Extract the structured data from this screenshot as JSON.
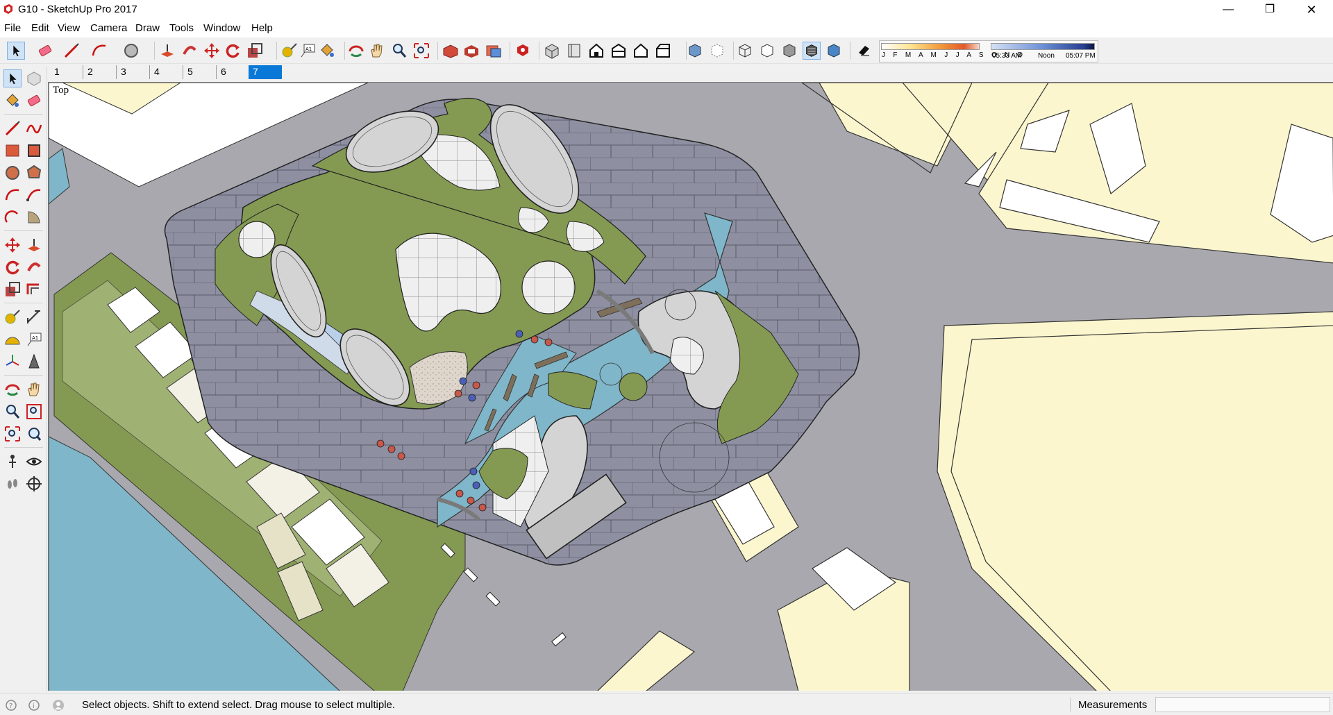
{
  "window": {
    "title": "G10 - SketchUp Pro 2017",
    "minimize_icon": "minimize-icon",
    "maximize_icon": "restore-icon",
    "close_icon": "close-icon"
  },
  "menu": [
    "File",
    "Edit",
    "View",
    "Camera",
    "Draw",
    "Tools",
    "Window",
    "Help"
  ],
  "toolbar": {
    "tools": [
      "select",
      "eraser",
      "line",
      "arc",
      "circle",
      "push-pull",
      "follow-me",
      "move",
      "rotate",
      "scale",
      "tape-measure",
      "text",
      "paint-bucket",
      "orbit",
      "pan",
      "zoom",
      "zoom-extents",
      "3d-warehouse",
      "extension-warehouse",
      "send-to-layout",
      "extension-manager",
      "iso-view",
      "top-view",
      "front-view",
      "right-view",
      "back-view",
      "left-view",
      "xray",
      "back-edges",
      "wireframe",
      "hidden-line",
      "shaded",
      "shaded-textures",
      "monochrome",
      "shadows"
    ],
    "shadow_months": "J F M A M J J A S O N D",
    "shadow_time_start": "05:33 AM",
    "shadow_time_mid": "Noon",
    "shadow_time_end": "05:07 PM"
  },
  "scenes": {
    "tabs": [
      "1",
      "2",
      "3",
      "4",
      "5",
      "6",
      "7"
    ],
    "active_index": 6
  },
  "viewport": {
    "view_label": "Top"
  },
  "status": {
    "hint": "Select objects. Shift to extend select. Drag mouse to select multiple.",
    "measurements_label": "Measurements",
    "measurements_value": ""
  },
  "colors": {
    "road": "#a8a8ae",
    "plaza": "#8f90a0",
    "lawn": "#849a52",
    "water": "#7fb6c9",
    "building_roof": "#d4d4d4",
    "neighbor_lot": "#fcf6cf",
    "active_tab": "#0a78d7"
  }
}
